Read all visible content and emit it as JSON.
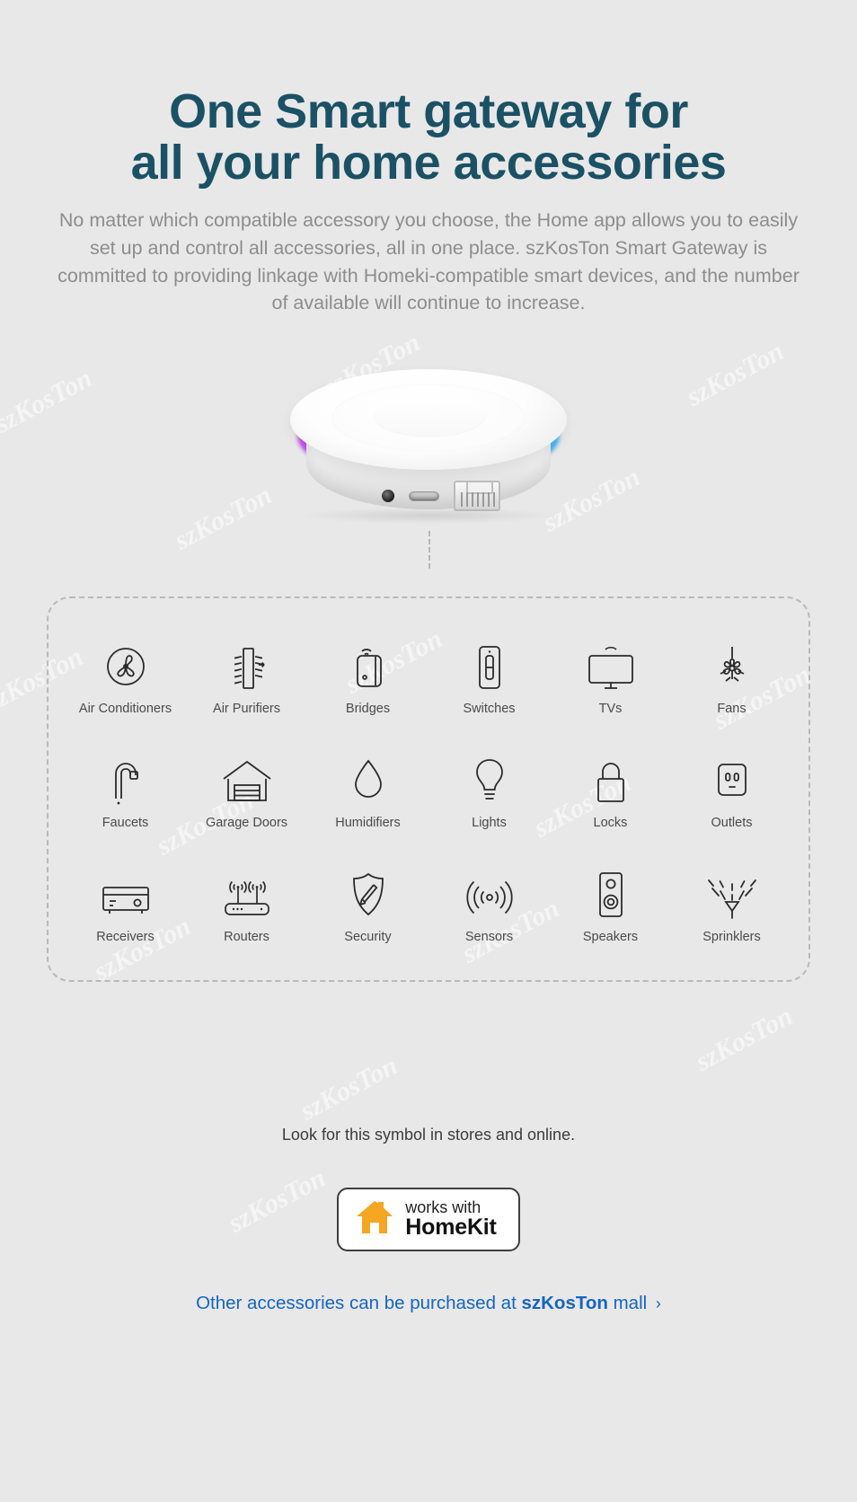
{
  "header": {
    "title_line1": "One Smart gateway for",
    "title_line2": "all your home accessories",
    "title_color": "#1b5165",
    "subtitle": "No matter which compatible accessory you choose, the Home app allows you to easily set up and control all accessories, all in one place. szKosTon Smart Gateway is committed to providing linkage with Homeki-compatible smart devices, and the number of available will continue to increase."
  },
  "device": {
    "name": "smart-gateway-hub",
    "ports": [
      "dc-power-port",
      "usb-port",
      "ethernet-lan-port"
    ]
  },
  "accessories": {
    "rows": [
      [
        {
          "label": "Air Conditioners",
          "icon": "air-conditioner-icon"
        },
        {
          "label": "Air Purifiers",
          "icon": "air-purifier-icon"
        },
        {
          "label": "Bridges",
          "icon": "bridge-icon"
        },
        {
          "label": "Switches",
          "icon": "switch-icon"
        },
        {
          "label": "TVs",
          "icon": "tv-icon"
        },
        {
          "label": "Fans",
          "icon": "fan-icon"
        }
      ],
      [
        {
          "label": "Faucets",
          "icon": "faucet-icon"
        },
        {
          "label": "Garage Doors",
          "icon": "garage-door-icon"
        },
        {
          "label": "Humidifiers",
          "icon": "humidifier-icon"
        },
        {
          "label": "Lights",
          "icon": "light-bulb-icon"
        },
        {
          "label": "Locks",
          "icon": "lock-icon"
        },
        {
          "label": "Outlets",
          "icon": "outlet-icon"
        }
      ],
      [
        {
          "label": "Receivers",
          "icon": "receiver-icon"
        },
        {
          "label": "Routers",
          "icon": "router-icon"
        },
        {
          "label": "Security",
          "icon": "security-shield-icon"
        },
        {
          "label": "Sensors",
          "icon": "sensor-icon"
        },
        {
          "label": "Speakers",
          "icon": "speaker-icon"
        },
        {
          "label": "Sprinklers",
          "icon": "sprinkler-icon"
        }
      ]
    ]
  },
  "footer": {
    "symbol_note": "Look for this symbol in stores and online.",
    "badge": {
      "works_with": "works with",
      "platform": "HomeKit",
      "house_color": "#f5a623"
    },
    "mall_link": {
      "prefix": "Other accessories can be purchased at",
      "brand": "szKosTon",
      "suffix": "mall",
      "chevron": "›",
      "color": "#1565c0"
    }
  },
  "watermarks": {
    "text": "szKosTon"
  }
}
